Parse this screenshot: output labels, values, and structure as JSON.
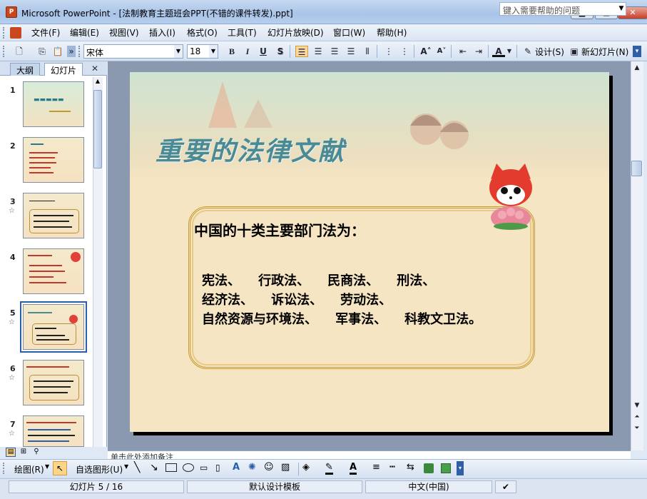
{
  "window": {
    "app_icon_label": "P",
    "title": "Microsoft PowerPoint - [法制教育主题班会PPT(不错的课件转发).ppt]",
    "minimize": "▁",
    "maximize": "□",
    "close": "✕"
  },
  "menu": {
    "items": [
      "文件(F)",
      "编辑(E)",
      "视图(V)",
      "插入(I)",
      "格式(O)",
      "工具(T)",
      "幻灯片放映(D)",
      "窗口(W)",
      "帮助(H)"
    ],
    "help_placeholder": "键入需要帮助的问题"
  },
  "toolbar": {
    "font_name": "宋体",
    "font_size": "18",
    "bold": "B",
    "italic": "I",
    "underline": "U",
    "shadow": "S",
    "design_label": "设计(S)",
    "new_slide_label": "新幻灯片(N)"
  },
  "left_pane": {
    "tab_outline": "大纲",
    "tab_slides": "幻灯片",
    "close": "✕",
    "thumbnails": [
      {
        "num": "1",
        "star": ""
      },
      {
        "num": "2",
        "star": ""
      },
      {
        "num": "3",
        "star": "☆"
      },
      {
        "num": "4",
        "star": ""
      },
      {
        "num": "5",
        "star": "☆"
      },
      {
        "num": "6",
        "star": "☆"
      },
      {
        "num": "7",
        "star": "☆"
      }
    ]
  },
  "slide": {
    "title": "重要的法律文献",
    "heading": "中国的十类主要部门法为：",
    "lines": [
      "宪法、    行政法、    民商法、    刑法、",
      "经济法、    诉讼法、    劳动法、",
      "自然资源与环境法、    军事法、    科教文卫法。"
    ]
  },
  "notes_placeholder": "单击此处添加备注",
  "drawing_toolbar": {
    "draw_label": "绘图(R)",
    "autoshapes_label": "自选图形(U)"
  },
  "status": {
    "slide_indicator": "幻灯片 5 / 16",
    "template": "默认设计模板",
    "language": "中文(中国)"
  },
  "colors": {
    "slide_bg": "#f6e5c3",
    "title_color": "#4a8a94",
    "frame_color": "#c79a2e",
    "selection": "#2b5ea8"
  }
}
